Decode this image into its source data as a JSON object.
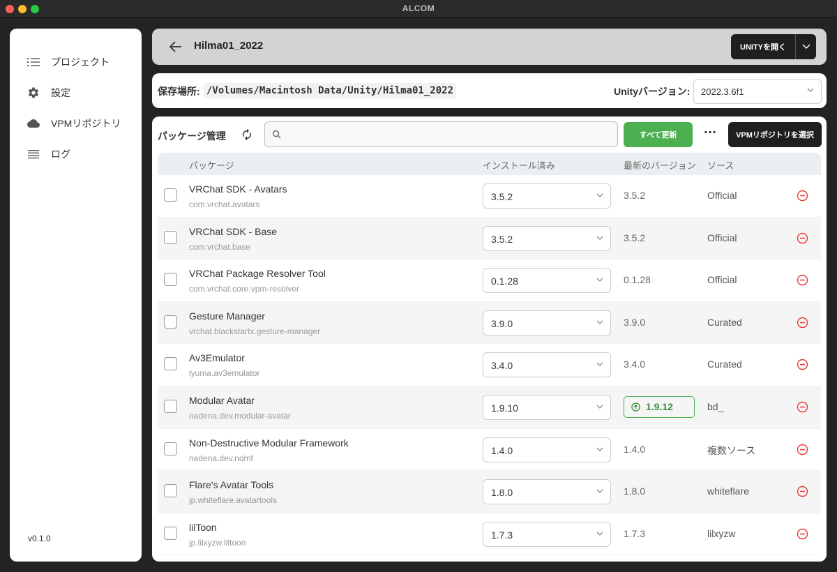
{
  "window": {
    "title": "ALCOM"
  },
  "sidebar": {
    "items": [
      {
        "label": "プロジェクト",
        "icon": "list-icon"
      },
      {
        "label": "設定",
        "icon": "gear-icon"
      },
      {
        "label": "VPMリポジトリ",
        "icon": "cloud-icon"
      },
      {
        "label": "ログ",
        "icon": "lines-icon"
      }
    ],
    "version": "v0.1.0"
  },
  "header": {
    "project_name": "Hilma01_2022",
    "open_unity_label": "UNITYを開く"
  },
  "location": {
    "label": "保存場所:",
    "path": "/Volumes/Macintosh Data/Unity/Hilma01_2022",
    "unity_version_label": "Unityバージョン:",
    "unity_version": "2022.3.6f1"
  },
  "packages": {
    "title": "パッケージ管理",
    "search_value": "",
    "update_all_label": "すべて更新",
    "more_label": "···",
    "select_repo_label": "VPMリポジトリを選択",
    "columns": [
      "パッケージ",
      "インストール済み",
      "最新のバージョン",
      "ソース"
    ],
    "rows": [
      {
        "name": "VRChat SDK - Avatars",
        "id": "com.vrchat.avatars",
        "installed": "3.5.2",
        "latest": "3.5.2",
        "update_available": false,
        "source": "Official"
      },
      {
        "name": "VRChat SDK - Base",
        "id": "com.vrchat.base",
        "installed": "3.5.2",
        "latest": "3.5.2",
        "update_available": false,
        "source": "Official"
      },
      {
        "name": "VRChat Package Resolver Tool",
        "id": "com.vrchat.core.vpm-resolver",
        "installed": "0.1.28",
        "latest": "0.1.28",
        "update_available": false,
        "source": "Official"
      },
      {
        "name": "Gesture Manager",
        "id": "vrchat.blackstartx.gesture-manager",
        "installed": "3.9.0",
        "latest": "3.9.0",
        "update_available": false,
        "source": "Curated"
      },
      {
        "name": "Av3Emulator",
        "id": "lyuma.av3emulator",
        "installed": "3.4.0",
        "latest": "3.4.0",
        "update_available": false,
        "source": "Curated"
      },
      {
        "name": "Modular Avatar",
        "id": "nadena.dev.modular-avatar",
        "installed": "1.9.10",
        "latest": "1.9.12",
        "update_available": true,
        "source": "bd_"
      },
      {
        "name": "Non-Destructive Modular Framework",
        "id": "nadena.dev.ndmf",
        "installed": "1.4.0",
        "latest": "1.4.0",
        "update_available": false,
        "source": "複数ソース"
      },
      {
        "name": "Flare's Avatar Tools",
        "id": "jp.whiteflare.avatartools",
        "installed": "1.8.0",
        "latest": "1.8.0",
        "update_available": false,
        "source": "whiteflare"
      },
      {
        "name": "lilToon",
        "id": "jp.lilxyzw.liltoon",
        "installed": "1.7.3",
        "latest": "1.7.3",
        "update_available": false,
        "source": "lilxyzw"
      }
    ]
  },
  "colors": {
    "accent_green": "#4caf50",
    "dark_button": "#1f1f1f",
    "remove_red": "#e53935"
  }
}
